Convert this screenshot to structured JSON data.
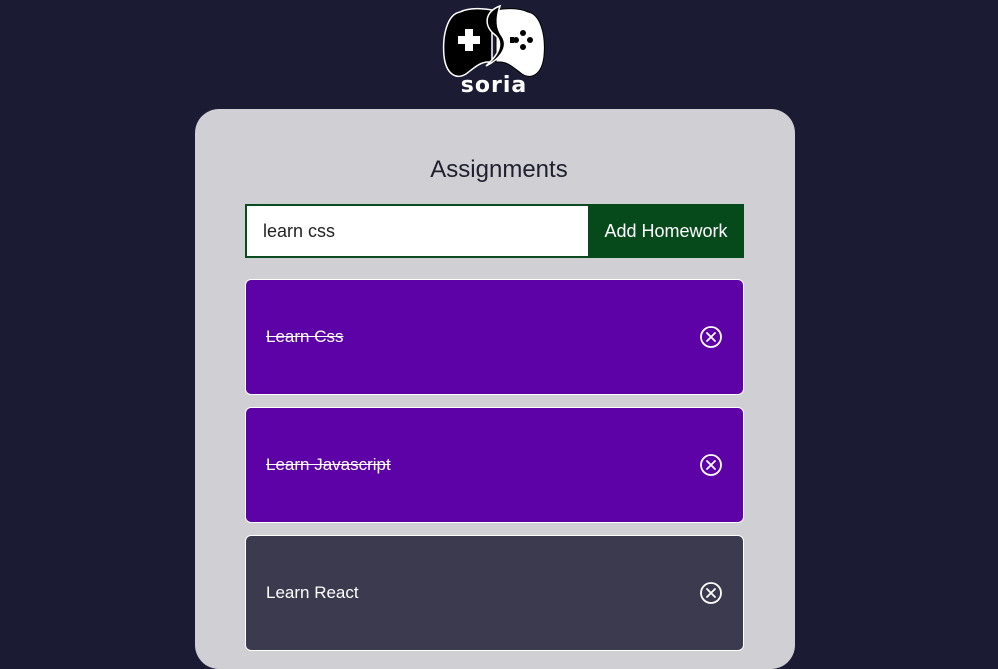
{
  "logo": {
    "text": "soria",
    "icon": "gamepad-icon"
  },
  "card": {
    "title": "Assignments"
  },
  "form": {
    "input_value": "learn css",
    "button_label": "Add Homework"
  },
  "tasks": [
    {
      "label": "Learn Css",
      "completed": true,
      "icon": "close-circle-icon"
    },
    {
      "label": "Learn Javascript",
      "completed": true,
      "icon": "close-circle-icon"
    },
    {
      "label": "Learn React",
      "completed": false,
      "icon": "close-circle-icon"
    }
  ],
  "colors": {
    "background": "#1b1b33",
    "card": "#d0cfd4",
    "button": "#064a1c",
    "task_completed": "#5c02a6",
    "task_pending": "#3b3a4f"
  }
}
